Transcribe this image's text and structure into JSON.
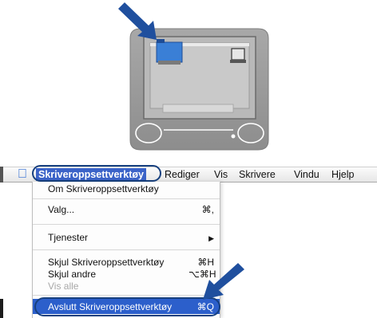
{
  "menubar": {
    "apple_icon": "apple-logo",
    "active_menu": "Skriveroppsettverktøy",
    "menus": [
      "Rediger",
      "Vis",
      "Skrivere",
      "Vindu",
      "Hjelp"
    ]
  },
  "dropdown": {
    "about": "Om Skriveroppsettverktøy",
    "prefs": "Valg...",
    "prefs_shortcut": "⌘,",
    "services": "Tjenester",
    "services_arrow": "▶",
    "hide": "Skjul Skriveroppsettverktøy",
    "hide_shortcut": "⌘H",
    "hide_others": "Skjul andre",
    "hide_others_shortcut": "⌥⌘H",
    "show_all": "Vis alle",
    "quit": "Avslutt Skriveroppsettverktøy",
    "quit_shortcut": "⌘Q"
  },
  "colors": {
    "highlight": "#2c5fcb",
    "oval": "#17407f",
    "arrow": "#1f4f9e",
    "monitor_bezel": "#9a9a9a",
    "screen_window": "#3a7fd6"
  }
}
